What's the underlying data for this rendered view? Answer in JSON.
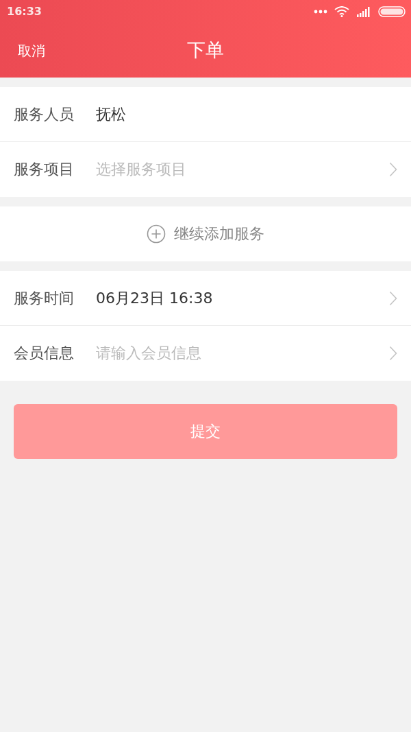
{
  "status_bar": {
    "time": "16:33"
  },
  "header": {
    "cancel": "取消",
    "title": "下单"
  },
  "sections": [
    {
      "rows": [
        {
          "label": "服务人员",
          "kind": "value",
          "text": "抚松",
          "chevron": false
        },
        {
          "label": "服务项目",
          "kind": "placeholder",
          "text": "选择服务项目",
          "chevron": true
        }
      ]
    },
    {
      "add_button": "继续添加服务"
    },
    {
      "rows": [
        {
          "label": "服务时间",
          "kind": "value",
          "text": "06月23日 16:38",
          "chevron": true
        },
        {
          "label": "会员信息",
          "kind": "placeholder",
          "text": "请输入会员信息",
          "chevron": true
        }
      ]
    }
  ],
  "submit": {
    "label": "提交",
    "disabled": true
  }
}
